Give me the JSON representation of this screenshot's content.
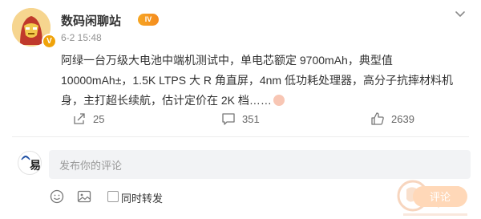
{
  "header": {
    "username": "数码闲聊站",
    "level_badge": "IV",
    "time": "6-2 15:48"
  },
  "post": {
    "text": "阿绿一台万级大电池中端机测试中，单电芯额定 9700mAh，典型值 10000mAh±，1.5K LTPS 大 R 角直屏，4nm 低功耗处理器，高分子抗摔材料机身，主打超长续航，估计定价在 2K 档……"
  },
  "actions": {
    "share_count": "25",
    "comment_count": "351",
    "like_count": "2639"
  },
  "comment": {
    "placeholder": "发布你的评论",
    "repost_label": "同时转发",
    "submit_label": "评论"
  },
  "colors": {
    "accent": "#f58b1f",
    "submit_bg": "#ffd8b8",
    "input_bg": "#f2f3f5"
  },
  "icons": {
    "more": "chevron-down-icon",
    "share": "share-icon",
    "comment": "comment-icon",
    "like": "like-icon",
    "emoji": "emoji-icon",
    "image": "image-icon",
    "verified": "verified-icon"
  }
}
